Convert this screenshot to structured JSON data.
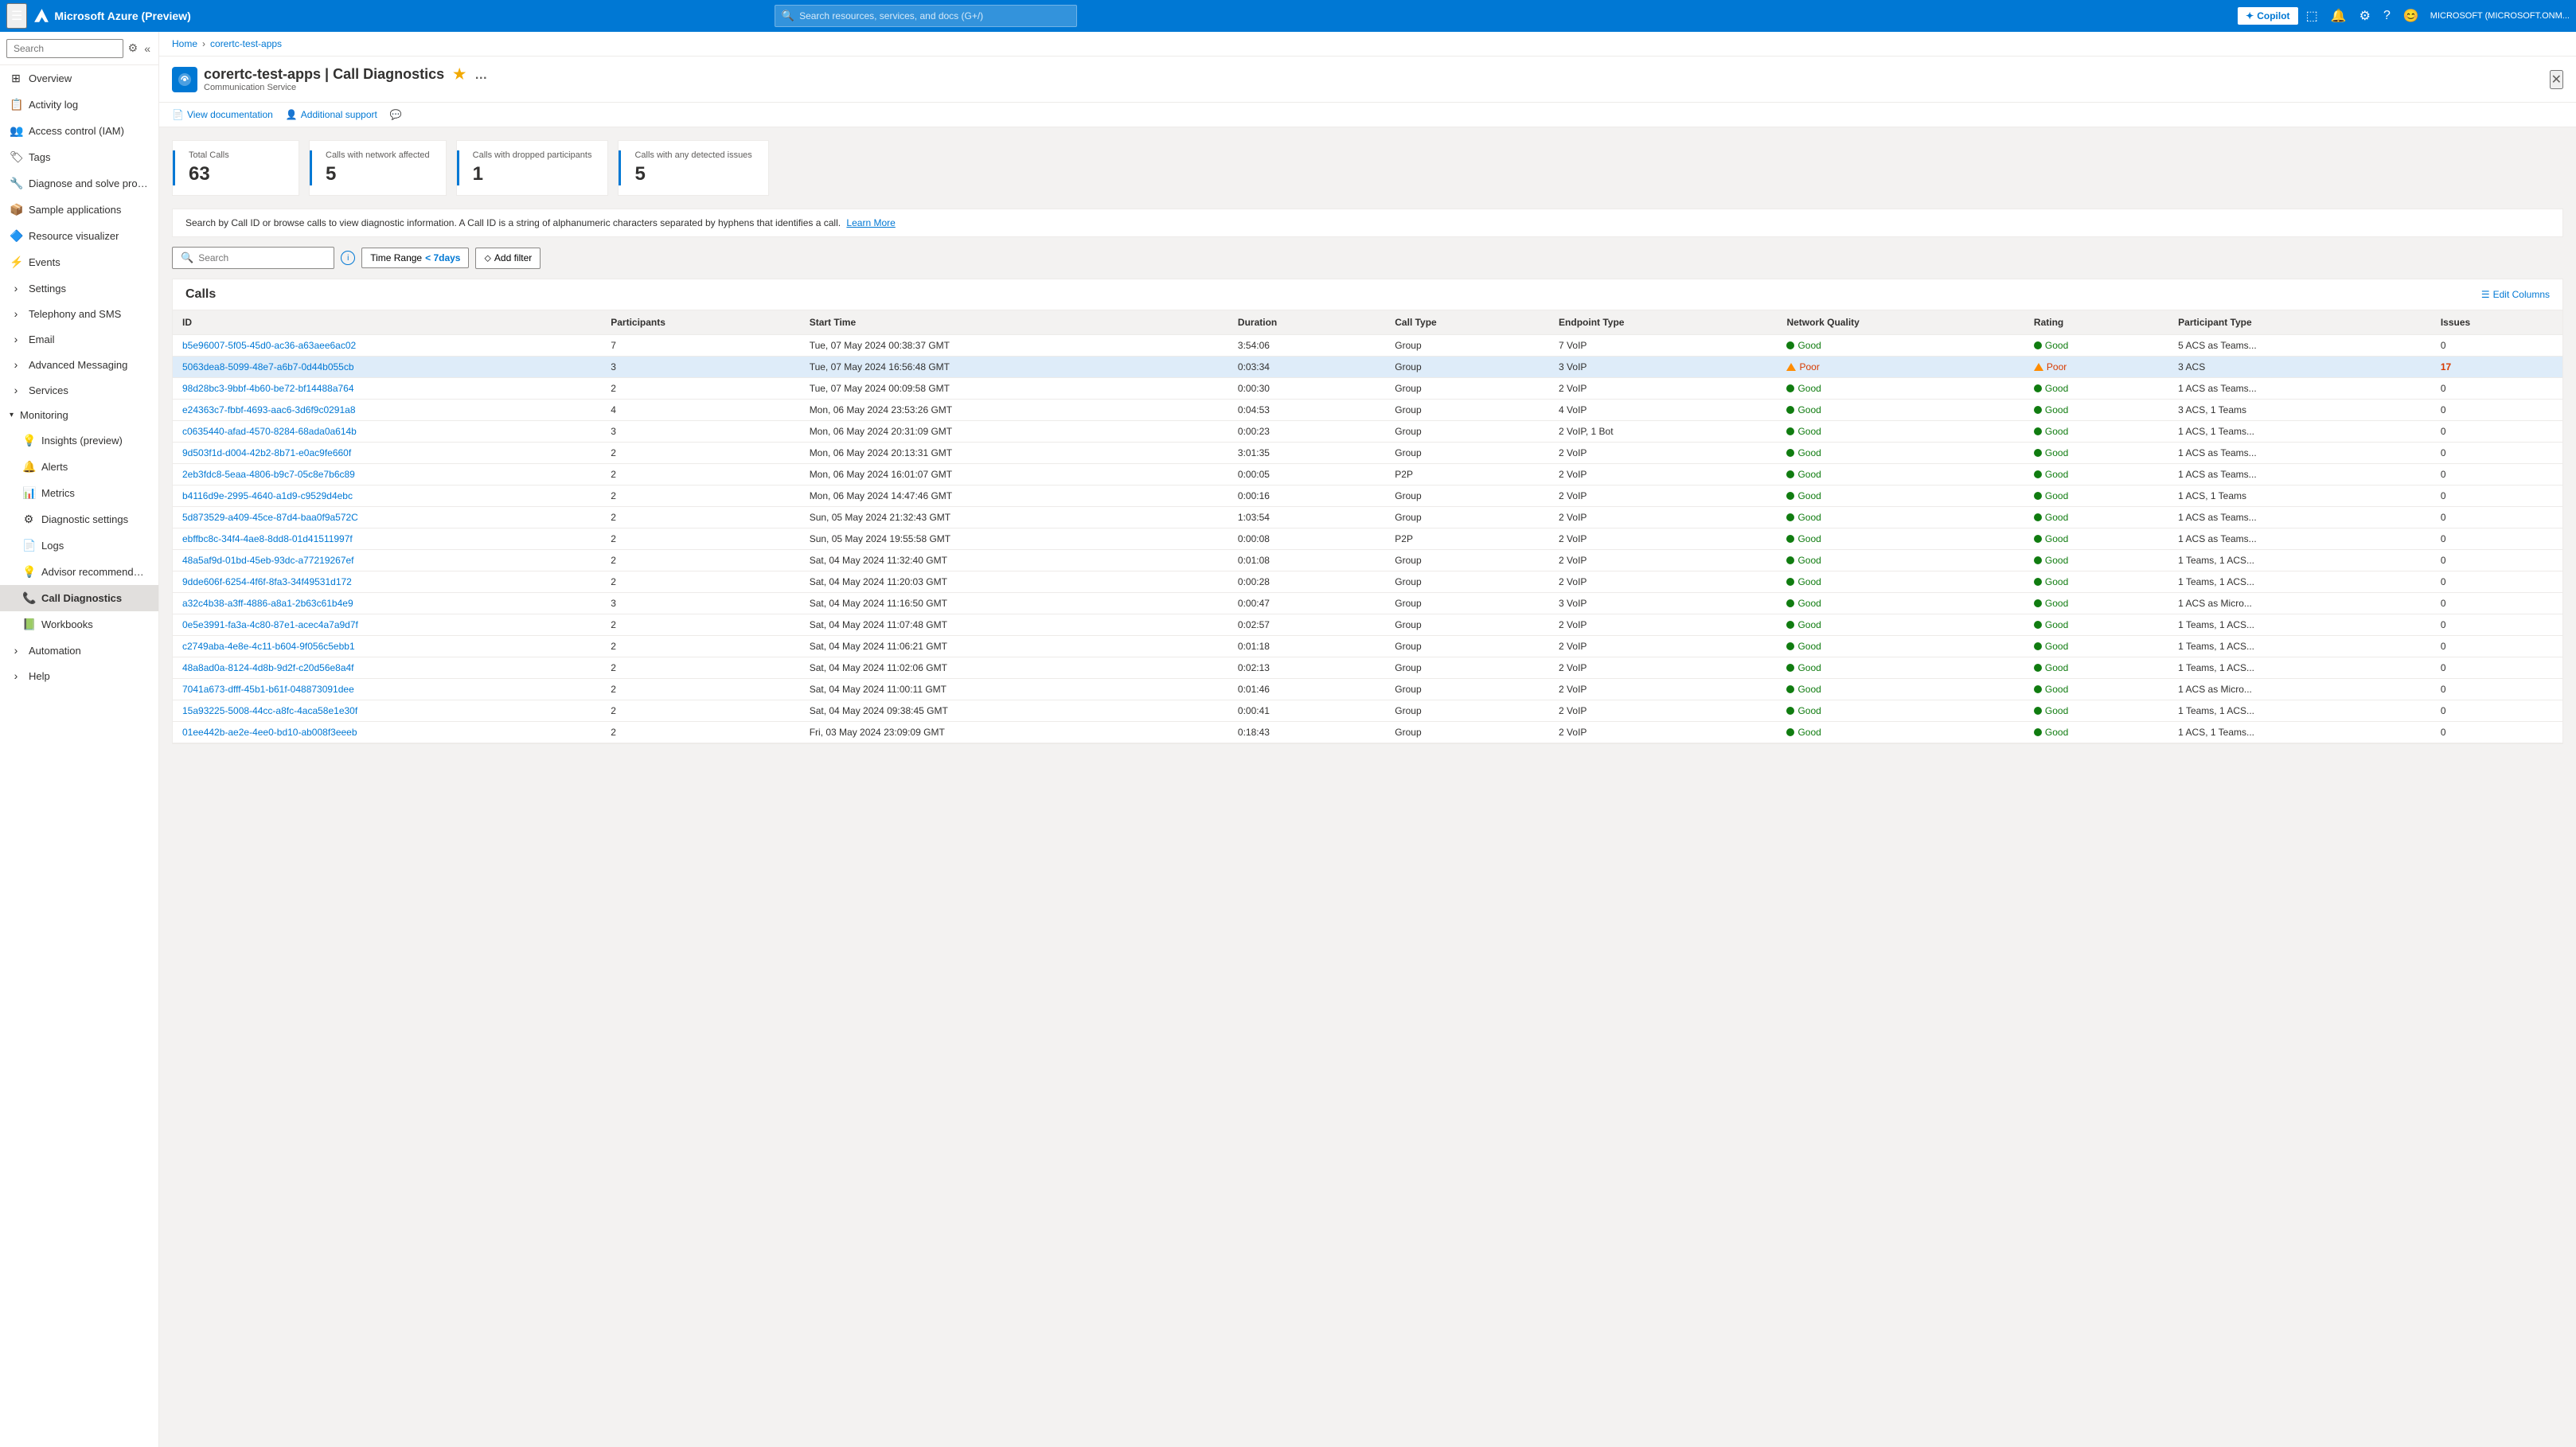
{
  "topNav": {
    "hamburger": "☰",
    "appName": "Microsoft Azure (Preview)",
    "searchPlaceholder": "Search resources, services, and docs (G+/)",
    "copilotLabel": "Copilot",
    "userInfo": "MICROSOFT (MICROSOFT.ONM..."
  },
  "breadcrumb": {
    "home": "Home",
    "resource": "corertc-test-apps"
  },
  "pageHeader": {
    "title": "corertc-test-apps | Call Diagnostics",
    "subtitle": "Communication Service",
    "star": "★",
    "more": "…"
  },
  "toolbar": {
    "viewDocs": "View documentation",
    "additionalSupport": "Additional support"
  },
  "sidebar": {
    "searchPlaceholder": "Search",
    "items": [
      {
        "id": "overview",
        "label": "Overview",
        "icon": "⊞"
      },
      {
        "id": "activity-log",
        "label": "Activity log",
        "icon": "📋"
      },
      {
        "id": "access-control",
        "label": "Access control (IAM)",
        "icon": "👥"
      },
      {
        "id": "tags",
        "label": "Tags",
        "icon": "🏷"
      },
      {
        "id": "diagnose",
        "label": "Diagnose and solve problems",
        "icon": "🔧"
      },
      {
        "id": "sample-apps",
        "label": "Sample applications",
        "icon": "📦"
      },
      {
        "id": "resource-visualizer",
        "label": "Resource visualizer",
        "icon": "🔷"
      },
      {
        "id": "events",
        "label": "Events",
        "icon": "⚡"
      },
      {
        "id": "settings",
        "label": "Settings",
        "icon": "⚙",
        "hasChevron": true
      },
      {
        "id": "telephony-sms",
        "label": "Telephony and SMS",
        "icon": "📞",
        "hasChevron": true
      },
      {
        "id": "email",
        "label": "Email",
        "icon": "✉",
        "hasChevron": true
      },
      {
        "id": "advanced-messaging",
        "label": "Advanced Messaging",
        "icon": "💬",
        "hasChevron": true
      },
      {
        "id": "services",
        "label": "Services",
        "icon": "🔗",
        "hasChevron": true
      }
    ],
    "monitoringGroup": {
      "label": "Monitoring",
      "expanded": true,
      "items": [
        {
          "id": "insights",
          "label": "Insights (preview)",
          "icon": "💡"
        },
        {
          "id": "alerts",
          "label": "Alerts",
          "icon": "🔔"
        },
        {
          "id": "metrics",
          "label": "Metrics",
          "icon": "📊"
        },
        {
          "id": "diagnostic-settings",
          "label": "Diagnostic settings",
          "icon": "⚙"
        },
        {
          "id": "logs",
          "label": "Logs",
          "icon": "📄"
        },
        {
          "id": "advisor",
          "label": "Advisor recommendations",
          "icon": "💡"
        },
        {
          "id": "call-diagnostics",
          "label": "Call Diagnostics",
          "icon": "📞",
          "active": true
        },
        {
          "id": "workbooks",
          "label": "Workbooks",
          "icon": "📗"
        }
      ]
    },
    "bottomItems": [
      {
        "id": "automation",
        "label": "Automation",
        "hasChevron": true
      },
      {
        "id": "help",
        "label": "Help",
        "hasChevron": true
      }
    ]
  },
  "stats": [
    {
      "label": "Total Calls",
      "value": "63"
    },
    {
      "label": "Calls with network affected",
      "value": "5"
    },
    {
      "label": "Calls with dropped participants",
      "value": "1"
    },
    {
      "label": "Calls with any detected issues",
      "value": "5"
    }
  ],
  "infoText": "Search by Call ID or browse calls to view diagnostic information. A Call ID is a string of alphanumeric characters separated by hyphens that identifies a call.",
  "learnMoreLabel": "Learn More",
  "searchBar": {
    "placeholder": "Search",
    "timeRange": "Time Range",
    "timeRangeValue": "< 7days",
    "addFilter": "Add filter"
  },
  "callsTable": {
    "title": "Calls",
    "editColumnsLabel": "Edit Columns",
    "columns": [
      "ID",
      "Participants",
      "Start Time",
      "Duration",
      "Call Type",
      "Endpoint Type",
      "Network Quality",
      "Rating",
      "Participant Type",
      "Issues"
    ],
    "rows": [
      {
        "id": "b5e96007-5f05-45d0-ac36-a63aee6ac02",
        "participants": "7",
        "startTime": "Tue, 07 May 2024 00:38:37 GMT",
        "duration": "3:54:06",
        "callType": "Group",
        "endpointType": "7 VoIP",
        "networkQuality": "Good",
        "rating": "Good",
        "participantType": "5 ACS as Teams...",
        "issues": "0",
        "highlighted": false
      },
      {
        "id": "5063dea8-5099-48e7-a6b7-0d44b055cb",
        "participants": "3",
        "startTime": "Tue, 07 May 2024 16:56:48 GMT",
        "duration": "0:03:34",
        "callType": "Group",
        "endpointType": "3 VoIP",
        "networkQuality": "Poor",
        "rating": "Poor",
        "participantType": "3 ACS",
        "issues": "17",
        "highlighted": true
      },
      {
        "id": "98d28bc3-9bbf-4b60-be72-bf14488a764",
        "participants": "2",
        "startTime": "Tue, 07 May 2024 00:09:58 GMT",
        "duration": "0:00:30",
        "callType": "Group",
        "endpointType": "2 VoIP",
        "networkQuality": "Good",
        "rating": "Good",
        "participantType": "1 ACS as Teams...",
        "issues": "0",
        "highlighted": false
      },
      {
        "id": "e24363c7-fbbf-4693-aac6-3d6f9c0291a8",
        "participants": "4",
        "startTime": "Mon, 06 May 2024 23:53:26 GMT",
        "duration": "0:04:53",
        "callType": "Group",
        "endpointType": "4 VoIP",
        "networkQuality": "Good",
        "rating": "Good",
        "participantType": "3 ACS, 1 Teams",
        "issues": "0",
        "highlighted": false
      },
      {
        "id": "c0635440-afad-4570-8284-68ada0a614b",
        "participants": "3",
        "startTime": "Mon, 06 May 2024 20:31:09 GMT",
        "duration": "0:00:23",
        "callType": "Group",
        "endpointType": "2 VoIP, 1 Bot",
        "networkQuality": "Good",
        "rating": "Good",
        "participantType": "1 ACS, 1 Teams...",
        "issues": "0",
        "highlighted": false
      },
      {
        "id": "9d503f1d-d004-42b2-8b71-e0ac9fe660f",
        "participants": "2",
        "startTime": "Mon, 06 May 2024 20:13:31 GMT",
        "duration": "3:01:35",
        "callType": "Group",
        "endpointType": "2 VoIP",
        "networkQuality": "Good",
        "rating": "Good",
        "participantType": "1 ACS as Teams...",
        "issues": "0",
        "highlighted": false
      },
      {
        "id": "2eb3fdc8-5eaa-4806-b9c7-05c8e7b6c89",
        "participants": "2",
        "startTime": "Mon, 06 May 2024 16:01:07 GMT",
        "duration": "0:00:05",
        "callType": "P2P",
        "endpointType": "2 VoIP",
        "networkQuality": "Good",
        "rating": "Good",
        "participantType": "1 ACS as Teams...",
        "issues": "0",
        "highlighted": false
      },
      {
        "id": "b4116d9e-2995-4640-a1d9-c9529d4ebc",
        "participants": "2",
        "startTime": "Mon, 06 May 2024 14:47:46 GMT",
        "duration": "0:00:16",
        "callType": "Group",
        "endpointType": "2 VoIP",
        "networkQuality": "Good",
        "rating": "Good",
        "participantType": "1 ACS, 1 Teams",
        "issues": "0",
        "highlighted": false
      },
      {
        "id": "5d873529-a409-45ce-87d4-baa0f9a572C",
        "participants": "2",
        "startTime": "Sun, 05 May 2024 21:32:43 GMT",
        "duration": "1:03:54",
        "callType": "Group",
        "endpointType": "2 VoIP",
        "networkQuality": "Good",
        "rating": "Good",
        "participantType": "1 ACS as Teams...",
        "issues": "0",
        "highlighted": false
      },
      {
        "id": "ebffbc8c-34f4-4ae8-8dd8-01d41511997f",
        "participants": "2",
        "startTime": "Sun, 05 May 2024 19:55:58 GMT",
        "duration": "0:00:08",
        "callType": "P2P",
        "endpointType": "2 VoIP",
        "networkQuality": "Good",
        "rating": "Good",
        "participantType": "1 ACS as Teams...",
        "issues": "0",
        "highlighted": false
      },
      {
        "id": "48a5af9d-01bd-45eb-93dc-a77219267ef",
        "participants": "2",
        "startTime": "Sat, 04 May 2024 11:32:40 GMT",
        "duration": "0:01:08",
        "callType": "Group",
        "endpointType": "2 VoIP",
        "networkQuality": "Good",
        "rating": "Good",
        "participantType": "1 Teams, 1 ACS...",
        "issues": "0",
        "highlighted": false
      },
      {
        "id": "9dde606f-6254-4f6f-8fa3-34f49531d172",
        "participants": "2",
        "startTime": "Sat, 04 May 2024 11:20:03 GMT",
        "duration": "0:00:28",
        "callType": "Group",
        "endpointType": "2 VoIP",
        "networkQuality": "Good",
        "rating": "Good",
        "participantType": "1 Teams, 1 ACS...",
        "issues": "0",
        "highlighted": false
      },
      {
        "id": "a32c4b38-a3ff-4886-a8a1-2b63c61b4e9",
        "participants": "3",
        "startTime": "Sat, 04 May 2024 11:16:50 GMT",
        "duration": "0:00:47",
        "callType": "Group",
        "endpointType": "3 VoIP",
        "networkQuality": "Good",
        "rating": "Good",
        "participantType": "1 ACS as Micro...",
        "issues": "0",
        "highlighted": false
      },
      {
        "id": "0e5e3991-fa3a-4c80-87e1-acec4a7a9d7f",
        "participants": "2",
        "startTime": "Sat, 04 May 2024 11:07:48 GMT",
        "duration": "0:02:57",
        "callType": "Group",
        "endpointType": "2 VoIP",
        "networkQuality": "Good",
        "rating": "Good",
        "participantType": "1 Teams, 1 ACS...",
        "issues": "0",
        "highlighted": false
      },
      {
        "id": "c2749aba-4e8e-4c11-b604-9f056c5ebb1",
        "participants": "2",
        "startTime": "Sat, 04 May 2024 11:06:21 GMT",
        "duration": "0:01:18",
        "callType": "Group",
        "endpointType": "2 VoIP",
        "networkQuality": "Good",
        "rating": "Good",
        "participantType": "1 Teams, 1 ACS...",
        "issues": "0",
        "highlighted": false
      },
      {
        "id": "48a8ad0a-8124-4d8b-9d2f-c20d56e8a4f",
        "participants": "2",
        "startTime": "Sat, 04 May 2024 11:02:06 GMT",
        "duration": "0:02:13",
        "callType": "Group",
        "endpointType": "2 VoIP",
        "networkQuality": "Good",
        "rating": "Good",
        "participantType": "1 Teams, 1 ACS...",
        "issues": "0",
        "highlighted": false
      },
      {
        "id": "7041a673-dfff-45b1-b61f-048873091dee",
        "participants": "2",
        "startTime": "Sat, 04 May 2024 11:00:11 GMT",
        "duration": "0:01:46",
        "callType": "Group",
        "endpointType": "2 VoIP",
        "networkQuality": "Good",
        "rating": "Good",
        "participantType": "1 ACS as Micro...",
        "issues": "0",
        "highlighted": false
      },
      {
        "id": "15a93225-5008-44cc-a8fc-4aca58e1e30f",
        "participants": "2",
        "startTime": "Sat, 04 May 2024 09:38:45 GMT",
        "duration": "0:00:41",
        "callType": "Group",
        "endpointType": "2 VoIP",
        "networkQuality": "Good",
        "rating": "Good",
        "participantType": "1 Teams, 1 ACS...",
        "issues": "0",
        "highlighted": false
      },
      {
        "id": "01ee442b-ae2e-4ee0-bd10-ab008f3eeeb",
        "participants": "2",
        "startTime": "Fri, 03 May 2024 23:09:09 GMT",
        "duration": "0:18:43",
        "callType": "Group",
        "endpointType": "2 VoIP",
        "networkQuality": "Good",
        "rating": "Good",
        "participantType": "1 ACS, 1 Teams...",
        "issues": "0",
        "highlighted": false
      }
    ]
  }
}
